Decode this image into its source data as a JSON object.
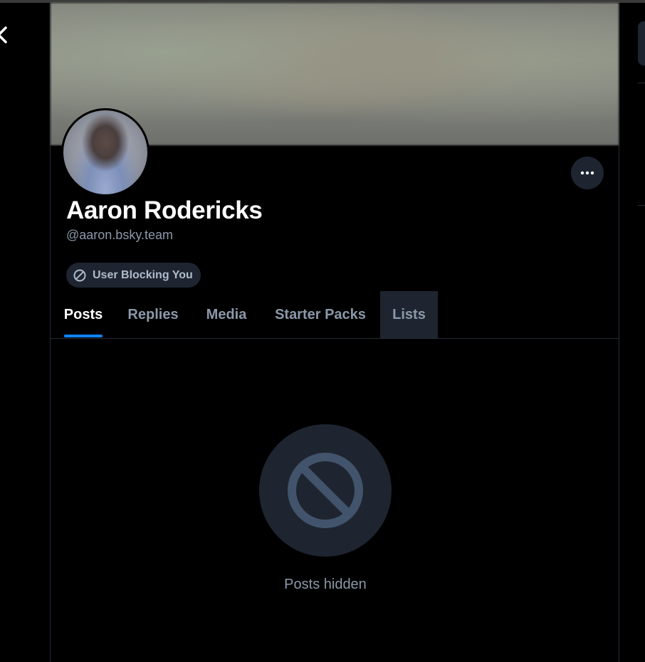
{
  "profile": {
    "display_name": "Aaron Rodericks",
    "handle": "@aaron.bsky.team",
    "block_badge_label": "User Blocking You"
  },
  "tabs": [
    {
      "label": "Posts",
      "active": true
    },
    {
      "label": "Replies",
      "active": false
    },
    {
      "label": "Media",
      "active": false
    },
    {
      "label": "Starter Packs",
      "active": false
    },
    {
      "label": "Lists",
      "active": false,
      "hovered": true
    }
  ],
  "feed": {
    "empty_label": "Posts hidden",
    "empty_icon": "block-icon"
  },
  "icons": {
    "back": "chevron-left-icon",
    "more": "ellipsis-icon",
    "badge": "block-icon"
  },
  "colors": {
    "background": "#000000",
    "surface": "#1e2530",
    "muted_text": "#8b98a9",
    "accent": "#1083fe",
    "icon_muted": "#41546c"
  }
}
